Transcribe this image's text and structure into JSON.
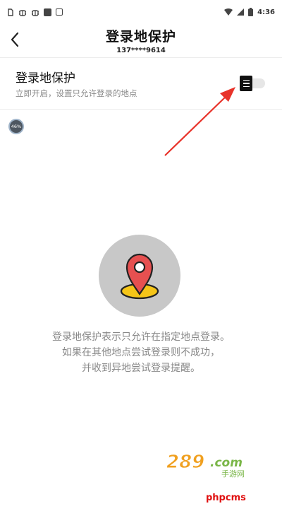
{
  "status_bar": {
    "time": "4:36",
    "icons": [
      "notification-icon",
      "bug-icon",
      "bug-icon",
      "app-icon",
      "app-icon",
      "wifi-icon",
      "signal-icon",
      "battery-icon"
    ]
  },
  "header": {
    "title": "登录地保护",
    "phone": "137****9614",
    "back_icon": "chevron-left-icon"
  },
  "setting": {
    "title": "登录地保护",
    "description": "立即开启，设置只允许登录的地点",
    "toggle_state": "off"
  },
  "badge": {
    "progress": "46%"
  },
  "illustration": {
    "icon": "location-pin-icon"
  },
  "info_lines": [
    "登录地保护表示只允许在指定地点登录。",
    "如果在其他地点尝试登录则不成功，",
    "并收到异地尝试登录提醒。"
  ],
  "watermark": {
    "logo_text": "289.com",
    "logo_sub": "手游网",
    "site": "phpcms"
  },
  "colors": {
    "arrow": "#e8332a",
    "pin": "#e65050",
    "pin_base": "#f5c518",
    "circle": "#c8c8c8"
  }
}
